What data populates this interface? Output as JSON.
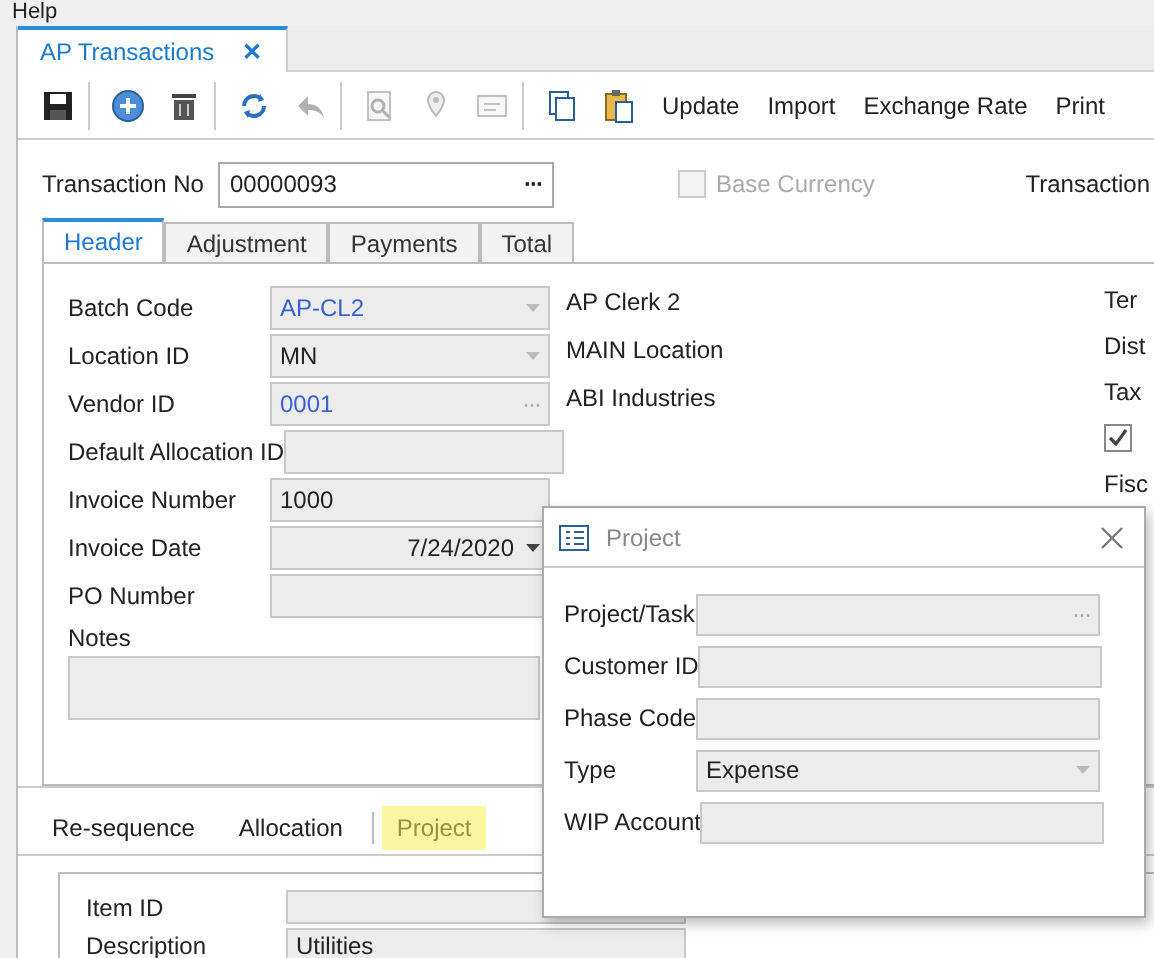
{
  "menu": {
    "items": [
      "Help"
    ]
  },
  "document_tab": {
    "title": "AP Transactions",
    "close": "✕"
  },
  "toolbar": {
    "icons": [
      {
        "kind": "save",
        "disabled": false
      },
      {
        "kind": "sep"
      },
      {
        "kind": "add",
        "disabled": false
      },
      {
        "kind": "delete",
        "disabled": false
      },
      {
        "kind": "sep"
      },
      {
        "kind": "refresh",
        "disabled": false
      },
      {
        "kind": "undo",
        "disabled": true
      },
      {
        "kind": "sep"
      },
      {
        "kind": "search",
        "disabled": true
      },
      {
        "kind": "pin",
        "disabled": true
      },
      {
        "kind": "card",
        "disabled": true
      },
      {
        "kind": "sep"
      },
      {
        "kind": "copy",
        "disabled": false
      },
      {
        "kind": "paste",
        "disabled": false
      }
    ],
    "buttons": [
      "Update",
      "Import",
      "Exchange Rate",
      "Print"
    ]
  },
  "transaction": {
    "label": "Transaction No",
    "value": "00000093",
    "lookup": "···",
    "base_currency": {
      "label": "Base Currency",
      "checked": false,
      "disabled": true
    },
    "right_label": "Transaction"
  },
  "tabs": [
    {
      "label": "Header",
      "selected": true
    },
    {
      "label": "Adjustment",
      "selected": false
    },
    {
      "label": "Payments",
      "selected": false
    },
    {
      "label": "Total",
      "selected": false
    }
  ],
  "fields": [
    {
      "label": "Batch Code",
      "value": "AP-CL2",
      "kind": "dropdown",
      "link": true,
      "description": "AP Clerk 2"
    },
    {
      "label": "Location ID",
      "value": "MN",
      "kind": "dropdown",
      "link": false,
      "description": "MAIN Location"
    },
    {
      "label": "Vendor ID",
      "value": "0001",
      "kind": "lookup",
      "lookup": "···",
      "link": true,
      "description": "ABI Industries"
    },
    {
      "label": "Default Allocation ID",
      "kind": "text"
    },
    {
      "label": "Invoice Number",
      "value": "1000",
      "kind": "text",
      "link": false
    },
    {
      "label": "Invoice Date",
      "value": "7/24/2020",
      "kind": "date",
      "link": false
    },
    {
      "label": "PO Number",
      "kind": "text"
    }
  ],
  "notes": {
    "label": "Notes"
  },
  "right_column": [
    {
      "kind": "label",
      "text": "Ter"
    },
    {
      "kind": "label",
      "text": "Dist"
    },
    {
      "kind": "label",
      "text": "Tax"
    },
    {
      "kind": "checkbox",
      "checked": true
    },
    {
      "kind": "label",
      "text": "Fisc"
    }
  ],
  "bottom_tabs": [
    {
      "label": "Re-sequence",
      "selected": false
    },
    {
      "label": "Allocation",
      "selected": false
    },
    {
      "label": "Project",
      "selected": true
    }
  ],
  "detail": {
    "fields": [
      {
        "label": "Item ID"
      },
      {
        "label": "Description",
        "value": "Utilities"
      }
    ]
  },
  "dialog": {
    "title": "Project",
    "fields": [
      {
        "label": "Project/Task",
        "kind": "lookup",
        "lookup": "···"
      },
      {
        "label": "Customer ID",
        "kind": "text"
      },
      {
        "label": "Phase Code",
        "kind": "text"
      },
      {
        "label": "Type",
        "value": "Expense",
        "kind": "dropdown"
      },
      {
        "label": "WIP Account",
        "kind": "text"
      }
    ]
  }
}
